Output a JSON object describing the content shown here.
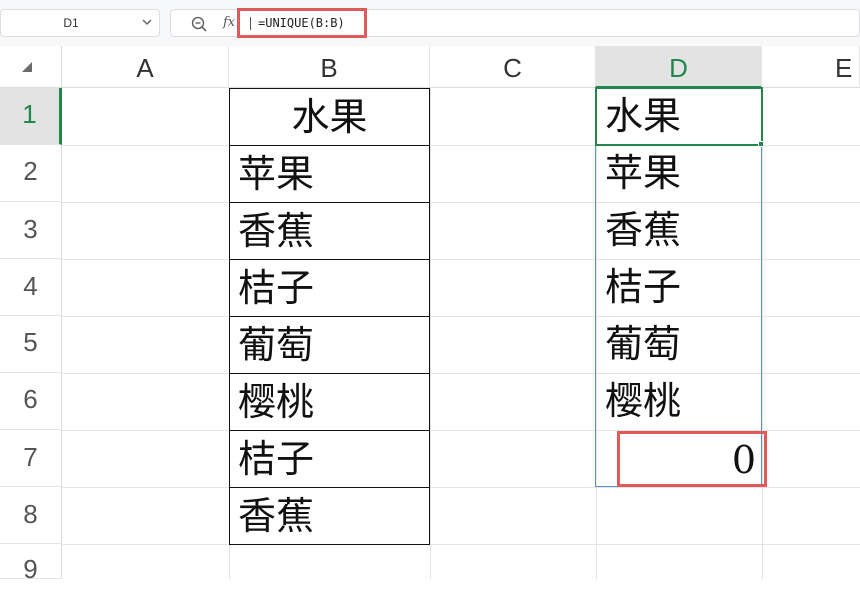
{
  "formula_bar": {
    "name_box": "D1",
    "fx_label": "fx",
    "formula": "=UNIQUE(B:B)"
  },
  "columns": [
    "A",
    "B",
    "C",
    "D",
    "E"
  ],
  "rows": [
    "1",
    "2",
    "3",
    "4",
    "5",
    "6",
    "7",
    "8",
    "9"
  ],
  "column_b": [
    "水果",
    "苹果",
    "香蕉",
    "桔子",
    "葡萄",
    "樱桃",
    "桔子",
    "香蕉"
  ],
  "column_d": [
    "水果",
    "苹果",
    "香蕉",
    "桔子",
    "葡萄",
    "樱桃"
  ],
  "d7_value": "0",
  "colors": {
    "selection": "#21874a",
    "highlight_box": "#e05a5a",
    "spill_border": "#5b8fd6"
  }
}
